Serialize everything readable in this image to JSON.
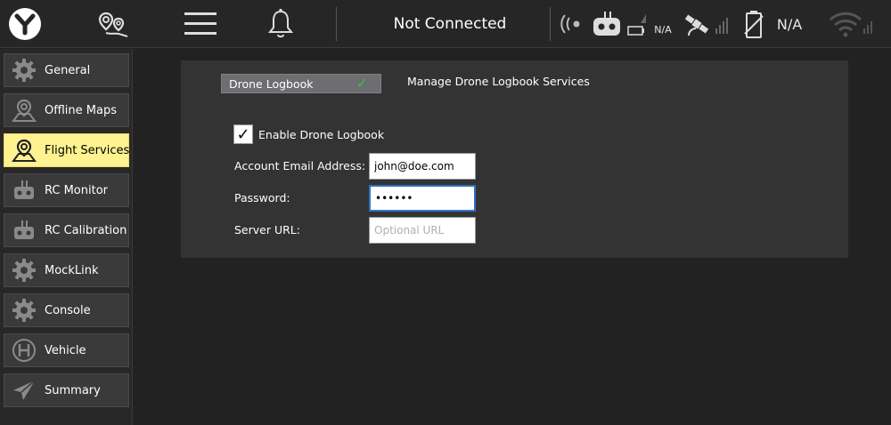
{
  "toolbar": {
    "status": "Not Connected",
    "battery_text": "N/A",
    "gps_text": "N/A"
  },
  "sidebar": {
    "items": [
      {
        "label": "General",
        "icon": "gear-icon"
      },
      {
        "label": "Offline Maps",
        "icon": "map-pin-icon"
      },
      {
        "label": "Flight Services",
        "icon": "map-pin-icon",
        "active": true
      },
      {
        "label": "RC Monitor",
        "icon": "rc-icon"
      },
      {
        "label": "RC Calibration",
        "icon": "rc-icon"
      },
      {
        "label": "MockLink",
        "icon": "gear-icon"
      },
      {
        "label": "Console",
        "icon": "gear-icon"
      },
      {
        "label": "Vehicle",
        "icon": "helipad-icon"
      },
      {
        "label": "Summary",
        "icon": "paper-plane-icon"
      }
    ]
  },
  "panel": {
    "section_title": "Drone Logbook",
    "section_desc": "Manage Drone Logbook Services",
    "enable_label": "Enable Drone Logbook",
    "fields": {
      "email": {
        "label": "Account Email Address:",
        "value": "john@doe.com"
      },
      "password": {
        "label": "Password:",
        "value": "••••••"
      },
      "server": {
        "label": "Server URL:",
        "placeholder": "Optional URL"
      }
    }
  },
  "colors": {
    "active_tab": "#fff290",
    "check_green": "#38c038",
    "focus_blue": "#2f72c4"
  }
}
